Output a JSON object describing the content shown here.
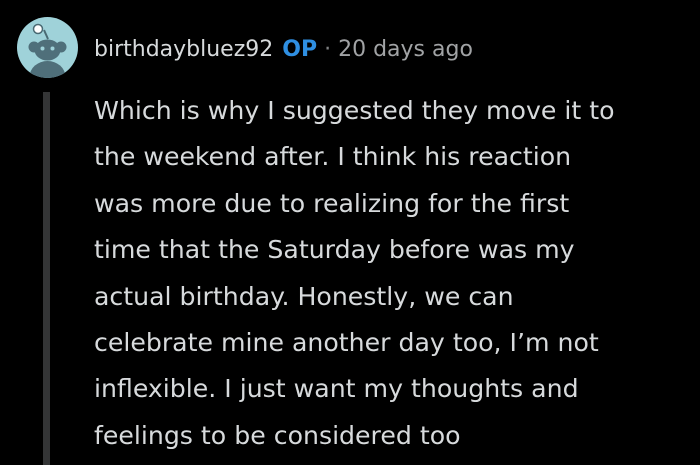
{
  "comment": {
    "username": "birthdaybluez92",
    "op_badge": "OP",
    "separator": "·",
    "timestamp": "20 days ago",
    "avatar_icon": "snoo-avatar-icon",
    "colors": {
      "background": "#000000",
      "text": "#d7dadc",
      "op_badge": "#2f8fe2",
      "thread_line": "#343536",
      "avatar_bg": "#9fd2d9"
    },
    "body_lines": [
      "Which is why I suggested they move it to",
      "the weekend after. I think his reaction",
      "was more due to realizing for the first",
      "time that the Saturday before was my",
      "actual birthday. Honestly, we can",
      "celebrate mine another day too, I’m not",
      "inflexible. I just want my thoughts and",
      "feelings to be considered too"
    ]
  }
}
